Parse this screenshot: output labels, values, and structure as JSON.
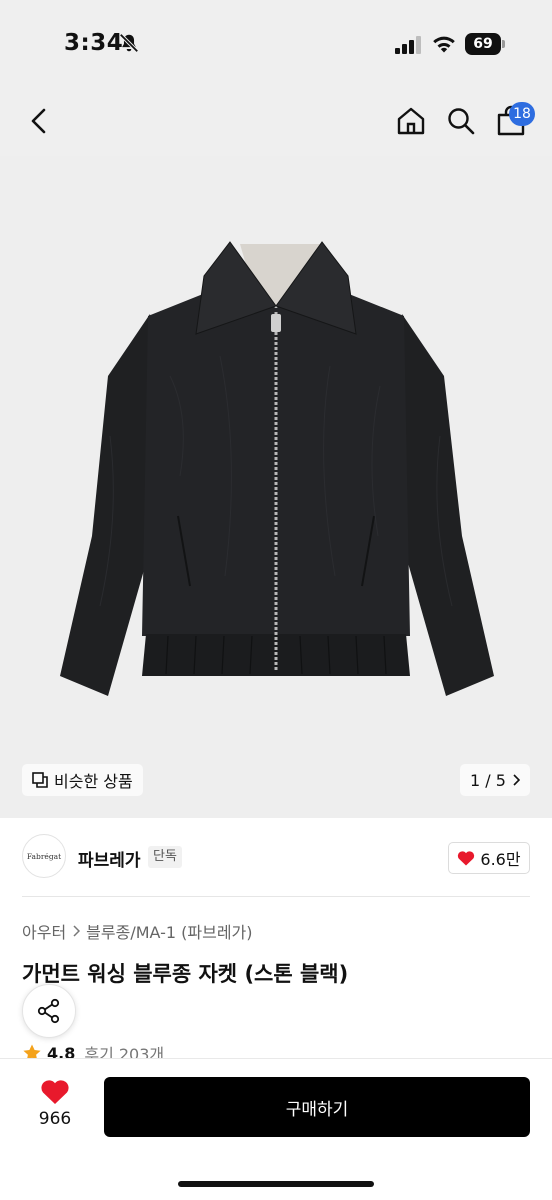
{
  "status_bar": {
    "time": "3:34",
    "battery": "69"
  },
  "nav": {
    "cart_count": "18"
  },
  "product_image": {
    "similar_label": "비슷한 상품",
    "page_indicator": "1 / 5"
  },
  "brand": {
    "logo_text": "Fabrégat",
    "name": "파브레가",
    "tag": "단독",
    "likes": "6.6만"
  },
  "product": {
    "breadcrumb": [
      "아우터",
      "블루종/MA-1 (파브레가)"
    ],
    "title": "가먼트 워싱 블루종 자켓 (스톤 블랙)",
    "rating": "4.8",
    "review_label": "후기 203개"
  },
  "bottom_bar": {
    "wish_count": "966",
    "buy_label": "구매하기"
  },
  "colors": {
    "accent_badge": "#2e6de0",
    "heart": "#e8192c",
    "star": "#f4a21b",
    "buy_button": "#000000"
  }
}
